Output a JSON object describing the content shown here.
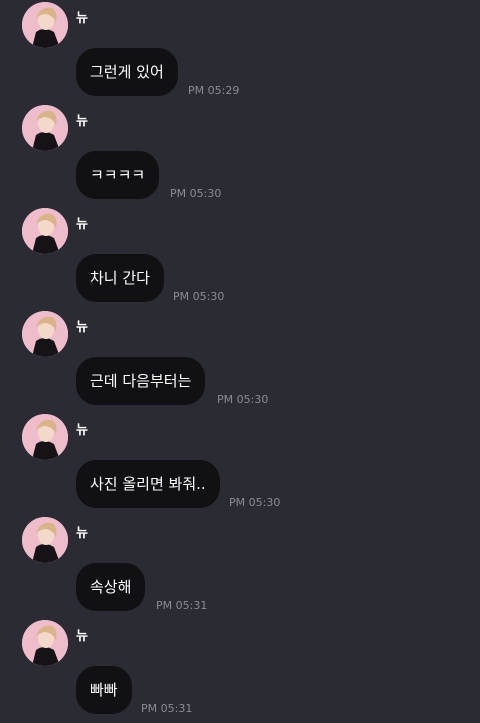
{
  "theme": {
    "background": "#2a2b33",
    "bubble": "#111114",
    "time_color": "#8a8b93"
  },
  "messages": [
    {
      "sender": "뉴",
      "text": "그런게 있어",
      "time": "PM 05:29"
    },
    {
      "sender": "뉴",
      "text": "ㅋㅋㅋㅋ",
      "time": "PM 05:30"
    },
    {
      "sender": "뉴",
      "text": "차니 간다",
      "time": "PM 05:30"
    },
    {
      "sender": "뉴",
      "text": "근데 다음부터는",
      "time": "PM 05:30"
    },
    {
      "sender": "뉴",
      "text": "사진 올리면 봐줘..",
      "time": "PM 05:30"
    },
    {
      "sender": "뉴",
      "text": "속상해",
      "time": "PM 05:31"
    },
    {
      "sender": "뉴",
      "text": "빠빠",
      "time": "PM 05:31"
    }
  ]
}
